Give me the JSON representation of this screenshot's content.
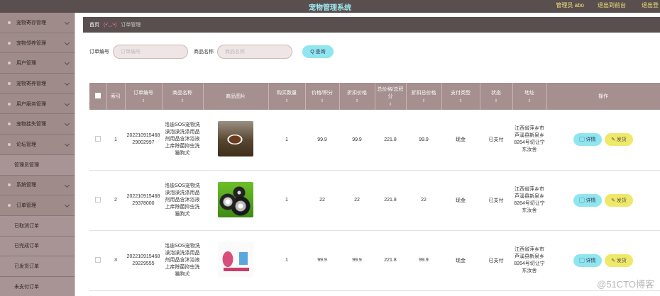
{
  "header": {
    "title": "宠物管理系统",
    "admin_label": "管理员 abo",
    "back_label": "退出到前台",
    "logout_label": "退出登"
  },
  "sidebar": {
    "items": [
      {
        "label": "宠物寄存管理",
        "sub": false
      },
      {
        "label": "宠物领养管理",
        "sub": false
      },
      {
        "label": "用户管理",
        "sub": false
      },
      {
        "label": "宠物寄养管理",
        "sub": false
      },
      {
        "label": "用户服务管理",
        "sub": false
      },
      {
        "label": "宠物挂失管理",
        "sub": false
      },
      {
        "label": "论坛管理",
        "sub": false
      },
      {
        "label": "管理员管理",
        "sub": true
      },
      {
        "label": "系统管理",
        "sub": false
      },
      {
        "label": "订单管理",
        "sub": false
      },
      {
        "label": "已取消订单",
        "sub": true
      },
      {
        "label": "已完成订单",
        "sub": true
      },
      {
        "label": "已发货订单",
        "sub": true
      },
      {
        "label": "未支付订单",
        "sub": true
      }
    ]
  },
  "breadcrumb": {
    "home": "首页",
    "emoticon": "(•'◡'•)",
    "current": "订单管理"
  },
  "search": {
    "order_label": "订单编号",
    "order_placeholder": "订单编号",
    "product_label": "商品名称",
    "product_placeholder": "商品名称",
    "query_label": "Q 查询"
  },
  "table": {
    "columns": [
      "",
      "索引",
      "订单编号",
      "商品名称",
      "商品图片",
      "购买数量",
      "价格/积分",
      "折扣价格",
      "总价格/总积分",
      "折扣总价格",
      "支付类型",
      "状态",
      "地址",
      "操作"
    ],
    "sort_glyph": "⇕",
    "detail_label": "▢ 详情",
    "ship_label": "✎ 发货",
    "rows": [
      {
        "index": "1",
        "order_no": "20221091546829002997",
        "product": "洛迪SOS宠物洗澡泡澡洗涤用品剂用品含沐浴液上痒除菌抑虫洗猫狗犬",
        "image": "dog-photo",
        "qty": "1",
        "price": "99.9",
        "discount_price": "99.9",
        "total": "221.8",
        "discount_total": "99.9",
        "pay_type": "现金",
        "status": "已支付",
        "address": "江西省萍乡市芦溪县新泉乡8264号切让宁东汝舍"
      },
      {
        "index": "2",
        "order_no": "20221091546829378000",
        "product": "洛迪SOS宠物洗澡泡澡洗涤用品剂用品含沐浴液上痒除菌抑虫洗猫狗犬",
        "image": "wheel-toys-photo",
        "qty": "1",
        "price": "22",
        "discount_price": "22",
        "total": "221.8",
        "discount_total": "22",
        "pay_type": "现金",
        "status": "已支付",
        "address": "江西省萍乡市芦溪县新泉乡8264号切让宁东汝舍"
      },
      {
        "index": "3",
        "order_no": "20221091546829229555",
        "product": "洛迪SOS宠物洗澡泡澡洗涤用品剂用品含沐浴液上痒除菌抑虫洗猫狗犬",
        "image": "pet-toy-photo",
        "qty": "1",
        "price": "99.9",
        "discount_price": "99.9",
        "total": "221.8",
        "discount_total": "99.9",
        "pay_type": "现金",
        "status": "已支付",
        "address": "江西省萍乡市芦溪县新泉乡8264号切让宁东汝舍"
      }
    ]
  },
  "watermark": "@51CTO博客"
}
